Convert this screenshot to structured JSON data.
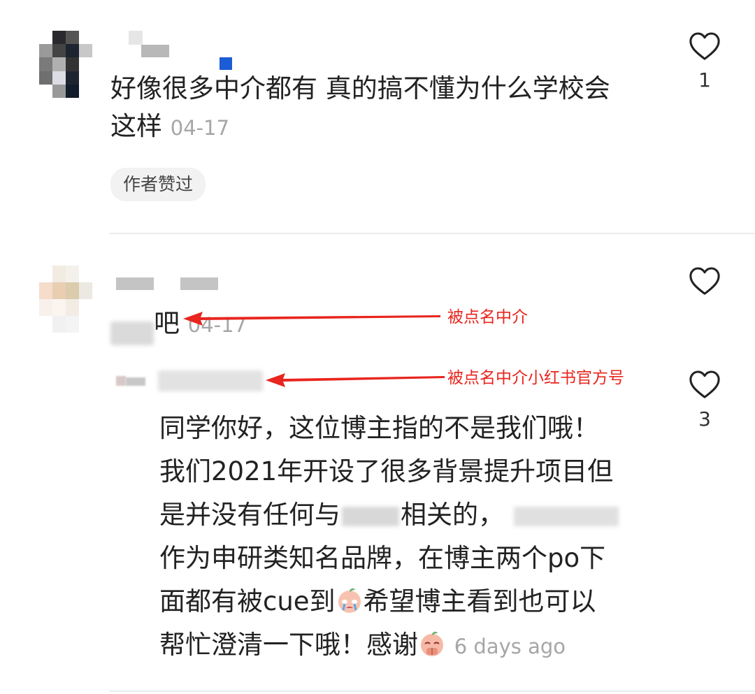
{
  "comments": [
    {
      "text_line1": "好像很多中介都有 真的搞不懂为什么学校会",
      "text_line2": "这样",
      "time": "04-17",
      "likes": "1",
      "badge": "作者赞过"
    },
    {
      "text_suffix": "吧",
      "time": "04-17",
      "reply": {
        "lines": [
          "同学你好，这位博主指的不是我们哦！",
          "我们2021年开设了很多背景提升项目但",
          "是并没有任何与",
          "相关的，",
          "作为申研类知名品牌，在博主两个po下",
          "面都有被cue到",
          "希望博主看到也可以",
          "帮忙澄清一下哦！感谢"
        ],
        "time": "6 days ago",
        "likes": "3"
      }
    }
  ],
  "annotations": {
    "arrow1": "被点名中介",
    "arrow2": "被点名中介小红书官方号"
  },
  "icons": {
    "like": "heart-outline-icon",
    "emoji1": "crying-face-emoji",
    "emoji2": "pleading-face-emoji"
  },
  "colors": {
    "annotation": "#e8251e",
    "timestamp": "#a6a6a6",
    "divider": "#ececec",
    "chip_bg": "#f2f2f2"
  }
}
